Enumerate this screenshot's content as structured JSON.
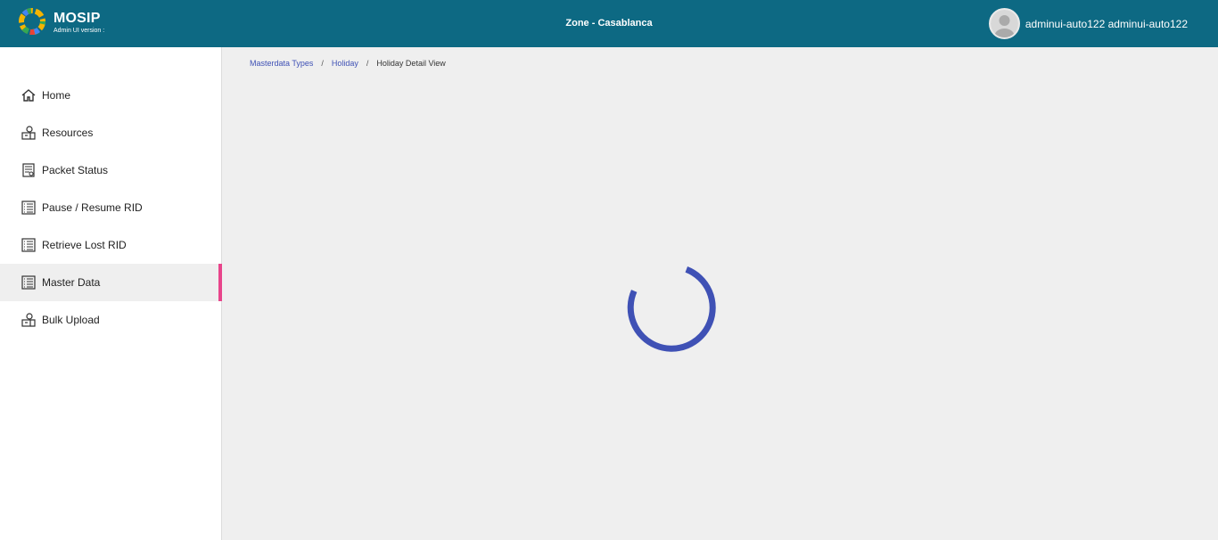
{
  "header": {
    "logo_title": "MOSIP",
    "logo_subtitle": "Admin UI version :",
    "logo_icon": "mosip-logo-icon",
    "zone": "Zone - Casablanca",
    "user_name": "adminui-auto122 adminui-auto122",
    "avatar_icon": "user-avatar-icon",
    "bar_color": "#0d6983"
  },
  "sidebar": {
    "items": [
      {
        "label": "Home",
        "icon": "home-icon"
      },
      {
        "label": "Resources",
        "icon": "resources-icon"
      },
      {
        "label": "Packet Status",
        "icon": "packet-status-icon"
      },
      {
        "label": "Pause / Resume RID",
        "icon": "list-icon"
      },
      {
        "label": "Retrieve Lost RID",
        "icon": "list-icon"
      },
      {
        "label": "Master Data",
        "icon": "list-icon",
        "active": true
      },
      {
        "label": "Bulk Upload",
        "icon": "upload-icon"
      }
    ],
    "active_indicator_color": "#e8458b"
  },
  "breadcrumb": {
    "items": [
      "Masterdata Types",
      "Holiday",
      "Holiday Detail View"
    ],
    "separator": "/"
  },
  "loading": {
    "spinner_color": "#3f51b5"
  }
}
